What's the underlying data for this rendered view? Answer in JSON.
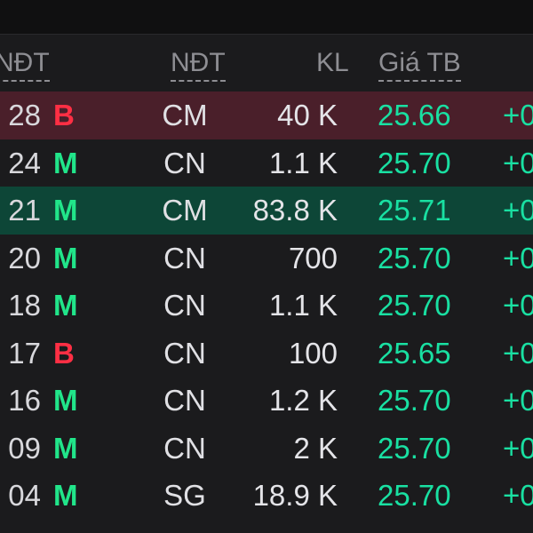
{
  "header": {
    "col_investor_1": "NĐT",
    "col_investor_2": "NĐT",
    "col_volume": "KL",
    "col_avg_price": "Giá TB"
  },
  "colors": {
    "background": "#1b1b1d",
    "sell_side": "#ff2f44",
    "buy_side": "#21e58a",
    "price": "#19e0a2",
    "sell_highlight": "#4a1f2a",
    "buy_highlight": "#0d4637"
  },
  "rows": [
    {
      "time": "28",
      "side": "B",
      "investor": "CM",
      "volume": "40 K",
      "price": "25.66",
      "change": "+0",
      "highlight": "sell"
    },
    {
      "time": "24",
      "side": "M",
      "investor": "CN",
      "volume": "1.1 K",
      "price": "25.70",
      "change": "+0",
      "highlight": "none"
    },
    {
      "time": "21",
      "side": "M",
      "investor": "CM",
      "volume": "83.8 K",
      "price": "25.71",
      "change": "+0",
      "highlight": "buy"
    },
    {
      "time": "20",
      "side": "M",
      "investor": "CN",
      "volume": "700",
      "price": "25.70",
      "change": "+0",
      "highlight": "none"
    },
    {
      "time": "18",
      "side": "M",
      "investor": "CN",
      "volume": "1.1 K",
      "price": "25.70",
      "change": "+0",
      "highlight": "none"
    },
    {
      "time": "17",
      "side": "B",
      "investor": "CN",
      "volume": "100",
      "price": "25.65",
      "change": "+0",
      "highlight": "none"
    },
    {
      "time": "16",
      "side": "M",
      "investor": "CN",
      "volume": "1.2 K",
      "price": "25.70",
      "change": "+0",
      "highlight": "none"
    },
    {
      "time": "09",
      "side": "M",
      "investor": "CN",
      "volume": "2 K",
      "price": "25.70",
      "change": "+0",
      "highlight": "none"
    },
    {
      "time": "04",
      "side": "M",
      "investor": "SG",
      "volume": "18.9 K",
      "price": "25.70",
      "change": "+0",
      "highlight": "none"
    }
  ]
}
